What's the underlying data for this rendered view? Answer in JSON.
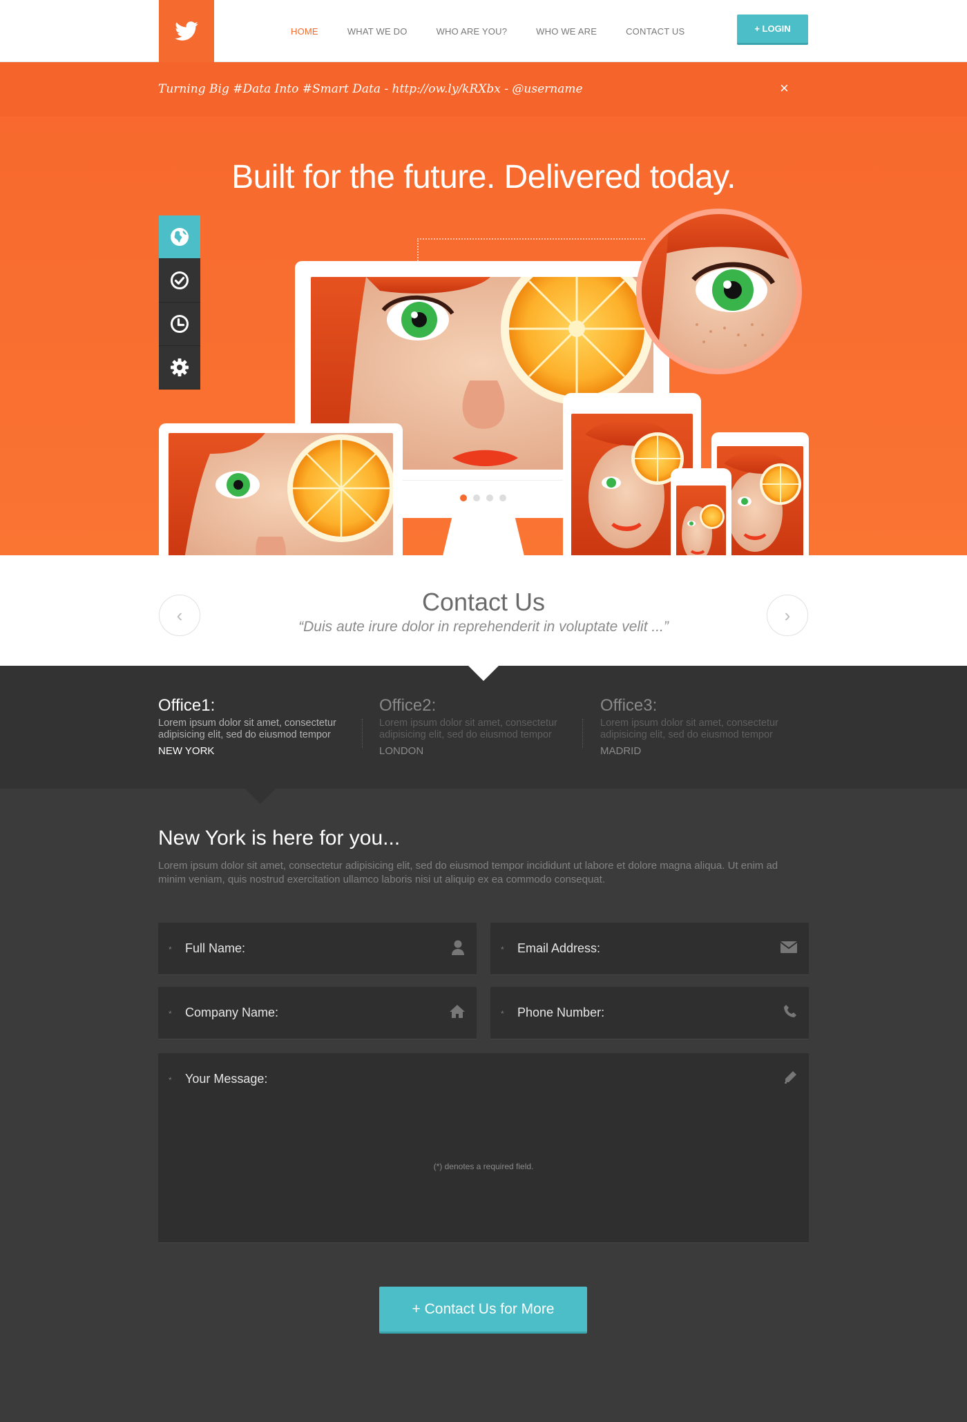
{
  "header": {
    "nav": [
      "HOME",
      "WHAT WE DO",
      "WHO ARE YOU?",
      "WHO WE ARE",
      "CONTACT US"
    ],
    "login_label": "+ LOGIN"
  },
  "tweet": {
    "text": "Turning Big #Data Into #Smart Data - http://ow.ly/kRXbx  - @username",
    "close": "×"
  },
  "hero": {
    "title": "Built for the future. Delivered today.",
    "side_tabs": [
      "globe-icon",
      "check-icon",
      "clock-icon",
      "gear-icon"
    ],
    "carousel_slides": 4,
    "carousel_active": 1
  },
  "slider": {
    "prev": "‹",
    "next": "›",
    "title": "Contact Us",
    "quote": "“Duis aute irure dolor in reprehenderit in voluptate velit ...”"
  },
  "offices": [
    {
      "title": "Office1:",
      "text": "Lorem ipsum dolor sit amet, consectetur adipisicing elit, sed do eiusmod tempor",
      "city": "NEW YORK"
    },
    {
      "title": "Office2:",
      "text": "Lorem ipsum dolor sit amet, consectetur adipisicing elit, sed do eiusmod tempor",
      "city": "LONDON"
    },
    {
      "title": "Office3:",
      "text": "Lorem ipsum dolor sit amet, consectetur adipisicing elit, sed do eiusmod tempor",
      "city": "MADRID"
    }
  ],
  "form": {
    "title": "New York is here for you...",
    "description": "Lorem ipsum dolor sit amet, consectetur adipisicing elit, sed do eiusmod tempor incididunt ut labore et dolore magna aliqua. Ut enim ad minim veniam, quis nostrud exercitation ullamco laboris nisi ut aliquip ex ea commodo consequat.",
    "required_mark": "*",
    "fields": {
      "full_name": "Full Name:",
      "email": "Email Address:",
      "company": "Company Name:",
      "phone": "Phone Number:",
      "message": "Your Message:"
    },
    "required_note": "(*) denotes a required field.",
    "submit_label": "+ Contact Us for More"
  },
  "colors": {
    "orange": "#f86f2f",
    "teal": "#4bbec7",
    "dark": "#333333"
  }
}
